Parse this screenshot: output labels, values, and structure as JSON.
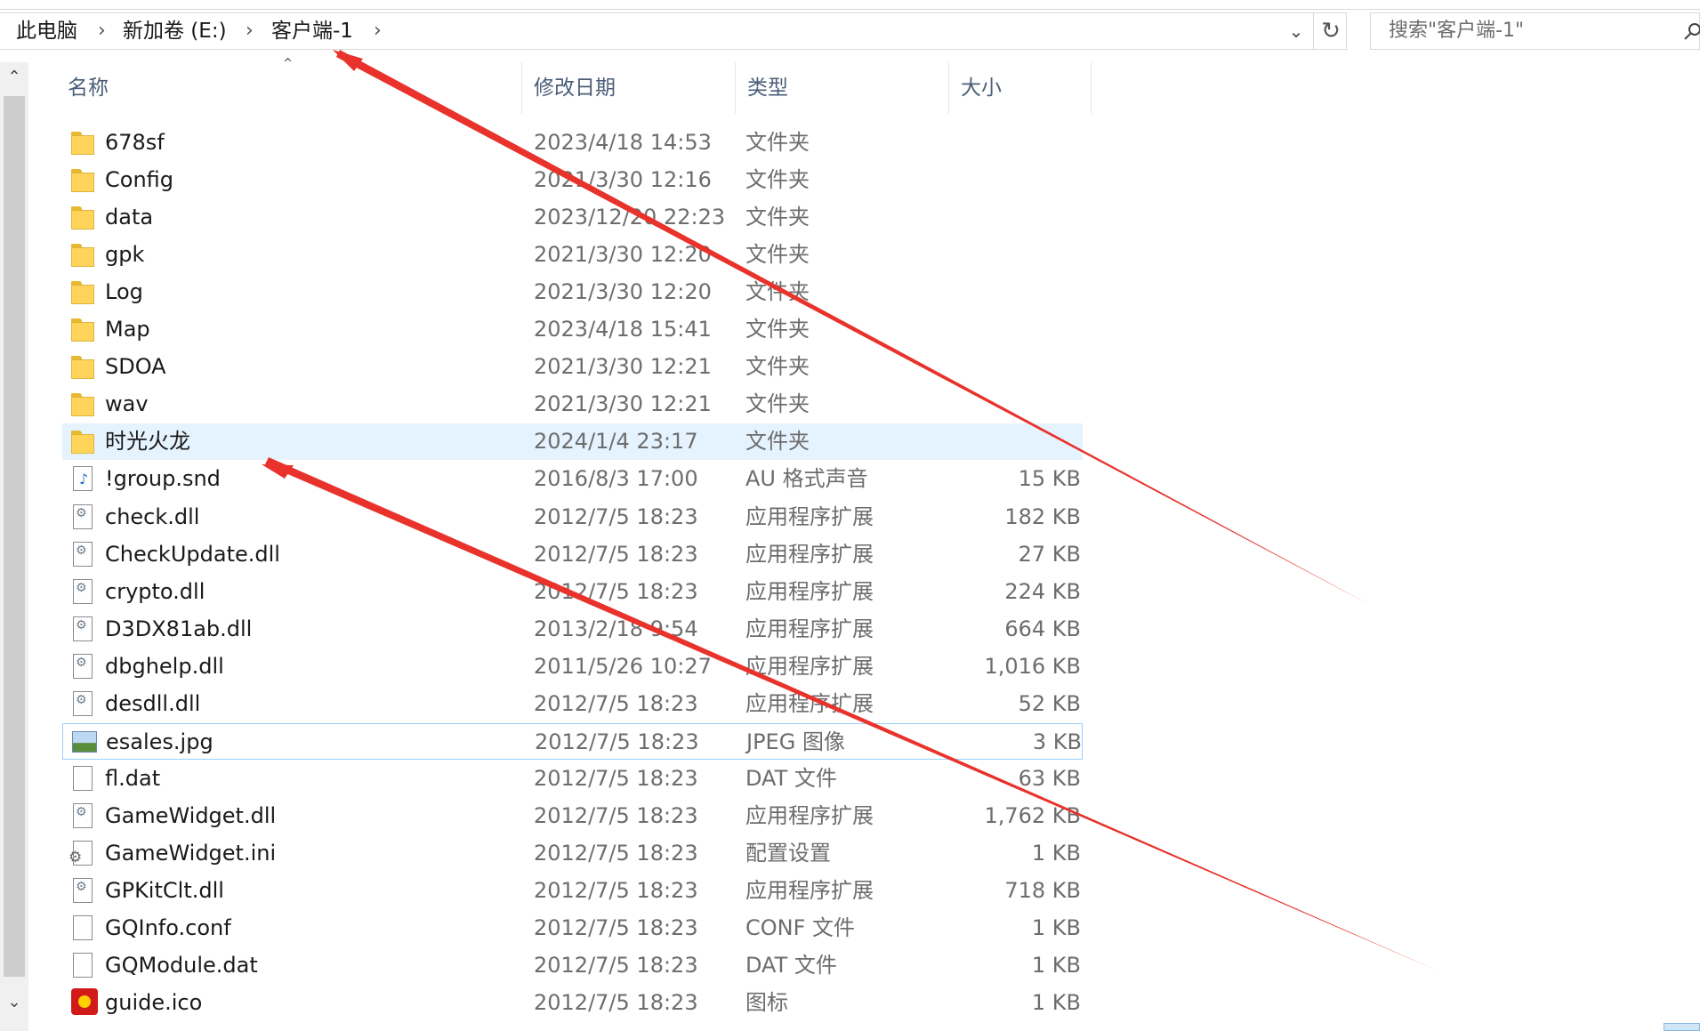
{
  "breadcrumb": {
    "items": [
      "此电脑",
      "新加卷 (E:)",
      "客户端-1"
    ]
  },
  "search": {
    "placeholder": "搜索\"客户端-1\""
  },
  "columns": {
    "name": "名称",
    "date": "修改日期",
    "type": "类型",
    "size": "大小"
  },
  "files": [
    {
      "name": "678sf",
      "date": "2023/4/18 14:53",
      "type": "文件夹",
      "size": "",
      "icon": "folder-icon"
    },
    {
      "name": "Config",
      "date": "2021/3/30 12:16",
      "type": "文件夹",
      "size": "",
      "icon": "folder-icon"
    },
    {
      "name": "data",
      "date": "2023/12/20 22:23",
      "type": "文件夹",
      "size": "",
      "icon": "folder-icon"
    },
    {
      "name": "gpk",
      "date": "2021/3/30 12:20",
      "type": "文件夹",
      "size": "",
      "icon": "folder-icon"
    },
    {
      "name": "Log",
      "date": "2021/3/30 12:20",
      "type": "文件夹",
      "size": "",
      "icon": "folder-icon"
    },
    {
      "name": "Map",
      "date": "2023/4/18 15:41",
      "type": "文件夹",
      "size": "",
      "icon": "folder-icon"
    },
    {
      "name": "SDOA",
      "date": "2021/3/30 12:21",
      "type": "文件夹",
      "size": "",
      "icon": "folder-icon"
    },
    {
      "name": "wav",
      "date": "2021/3/30 12:21",
      "type": "文件夹",
      "size": "",
      "icon": "folder-icon"
    },
    {
      "name": "时光火龙",
      "date": "2024/1/4 23:17",
      "type": "文件夹",
      "size": "",
      "icon": "folder-icon"
    },
    {
      "name": "!group.snd",
      "date": "2016/8/3 17:00",
      "type": "AU 格式声音",
      "size": "15 KB",
      "icon": "audio-file-icon"
    },
    {
      "name": "check.dll",
      "date": "2012/7/5 18:23",
      "type": "应用程序扩展",
      "size": "182 KB",
      "icon": "dll-file-icon"
    },
    {
      "name": "CheckUpdate.dll",
      "date": "2012/7/5 18:23",
      "type": "应用程序扩展",
      "size": "27 KB",
      "icon": "dll-file-icon"
    },
    {
      "name": "crypto.dll",
      "date": "2012/7/5 18:23",
      "type": "应用程序扩展",
      "size": "224 KB",
      "icon": "dll-file-icon"
    },
    {
      "name": "D3DX81ab.dll",
      "date": "2013/2/18 9:54",
      "type": "应用程序扩展",
      "size": "664 KB",
      "icon": "dll-file-icon"
    },
    {
      "name": "dbghelp.dll",
      "date": "2011/5/26 10:27",
      "type": "应用程序扩展",
      "size": "1,016 KB",
      "icon": "dll-file-icon"
    },
    {
      "name": "desdll.dll",
      "date": "2012/7/5 18:23",
      "type": "应用程序扩展",
      "size": "52 KB",
      "icon": "dll-file-icon"
    },
    {
      "name": "esales.jpg",
      "date": "2012/7/5 18:23",
      "type": "JPEG 图像",
      "size": "3 KB",
      "icon": "image-file-icon"
    },
    {
      "name": "fl.dat",
      "date": "2012/7/5 18:23",
      "type": "DAT 文件",
      "size": "63 KB",
      "icon": "blank-file-icon"
    },
    {
      "name": "GameWidget.dll",
      "date": "2012/7/5 18:23",
      "type": "应用程序扩展",
      "size": "1,762 KB",
      "icon": "dll-file-icon"
    },
    {
      "name": "GameWidget.ini",
      "date": "2012/7/5 18:23",
      "type": "配置设置",
      "size": "1 KB",
      "icon": "config-file-icon"
    },
    {
      "name": "GPKitClt.dll",
      "date": "2012/7/5 18:23",
      "type": "应用程序扩展",
      "size": "718 KB",
      "icon": "dll-file-icon"
    },
    {
      "name": "GQInfo.conf",
      "date": "2012/7/5 18:23",
      "type": "CONF 文件",
      "size": "1 KB",
      "icon": "blank-file-icon"
    },
    {
      "name": "GQModule.dat",
      "date": "2012/7/5 18:23",
      "type": "DAT 文件",
      "size": "1 KB",
      "icon": "blank-file-icon"
    },
    {
      "name": "guide.ico",
      "date": "2012/7/5 18:23",
      "type": "图标",
      "size": "1 KB",
      "icon": "ico-file-icon"
    }
  ],
  "selected_index": 8,
  "focused_index": 16,
  "colors": {
    "selection": "#e5f3ff",
    "focus_border": "#99d1ff",
    "annotation_arrow": "#e8322b"
  }
}
